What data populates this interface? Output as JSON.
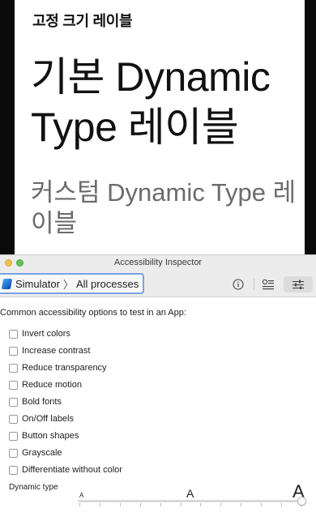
{
  "simulator": {
    "fixed_label": "고정 크기 레이블",
    "dynamic_label": "기본 Dynamic Type 레이블",
    "custom_label": "커스텀 Dynamic Type 레이블"
  },
  "inspector": {
    "window_title": "Accessibility Inspector",
    "target": {
      "device": "Simulator",
      "process": "All processes"
    },
    "toolbar_icons": [
      "info-icon",
      "inspect-icon",
      "settings-icon"
    ],
    "section_title": "Common accessibility options to test in an App:",
    "options": [
      {
        "label": "Invert colors",
        "checked": false
      },
      {
        "label": "Increase contrast",
        "checked": false
      },
      {
        "label": "Reduce transparency",
        "checked": false
      },
      {
        "label": "Reduce motion",
        "checked": false
      },
      {
        "label": "Bold fonts",
        "checked": false
      },
      {
        "label": "On/Off labels",
        "checked": false
      },
      {
        "label": "Button shapes",
        "checked": false
      },
      {
        "label": "Grayscale",
        "checked": false
      },
      {
        "label": "Differentiate without color",
        "checked": false
      }
    ],
    "dynamic_type": {
      "label": "Dynamic type",
      "small_glyph": "A",
      "medium_glyph": "A",
      "large_glyph": "A",
      "steps": 12,
      "level": 1.0
    }
  },
  "colors": {
    "simulator_bezel": "#0b0b0b",
    "focus_ring": "#7aa1e6",
    "traffic_orange": "#f5bd4f",
    "traffic_green": "#61c454"
  }
}
